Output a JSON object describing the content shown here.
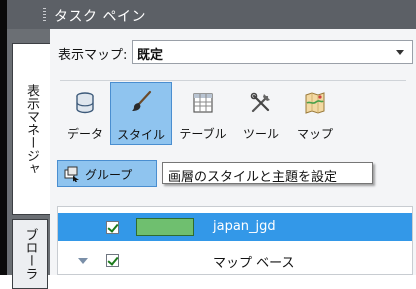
{
  "pane": {
    "title": "タスク ペイン"
  },
  "tabs": [
    {
      "label": "表示マネージャ",
      "active": true
    },
    {
      "label": "ブローラ",
      "active": false
    }
  ],
  "display_map": {
    "label": "表示マップ:",
    "value": "既定"
  },
  "toolbar": {
    "items": [
      {
        "label": "データ",
        "icon": "database-icon",
        "selected": false
      },
      {
        "label": "スタイル",
        "icon": "paintbrush-icon",
        "selected": true
      },
      {
        "label": "テーブル",
        "icon": "table-icon",
        "selected": false
      },
      {
        "label": "ツール",
        "icon": "tools-icon",
        "selected": false
      },
      {
        "label": "マップ",
        "icon": "map-icon",
        "selected": false
      }
    ]
  },
  "group_button": {
    "label": "グループ",
    "icon": "group-icon"
  },
  "tooltip": {
    "text": "画層のスタイルと主題を設定"
  },
  "layers": [
    {
      "name": "japan_jgd",
      "checked": true,
      "selected": true,
      "swatch_color": "#6fbf6f"
    },
    {
      "name": "マップ ベース",
      "checked": true,
      "selected": false,
      "expanded": true
    }
  ],
  "colors": {
    "title_bar": "#5c6066",
    "selection_blue": "#3398e8",
    "highlight_blue": "#8fc4ef"
  }
}
